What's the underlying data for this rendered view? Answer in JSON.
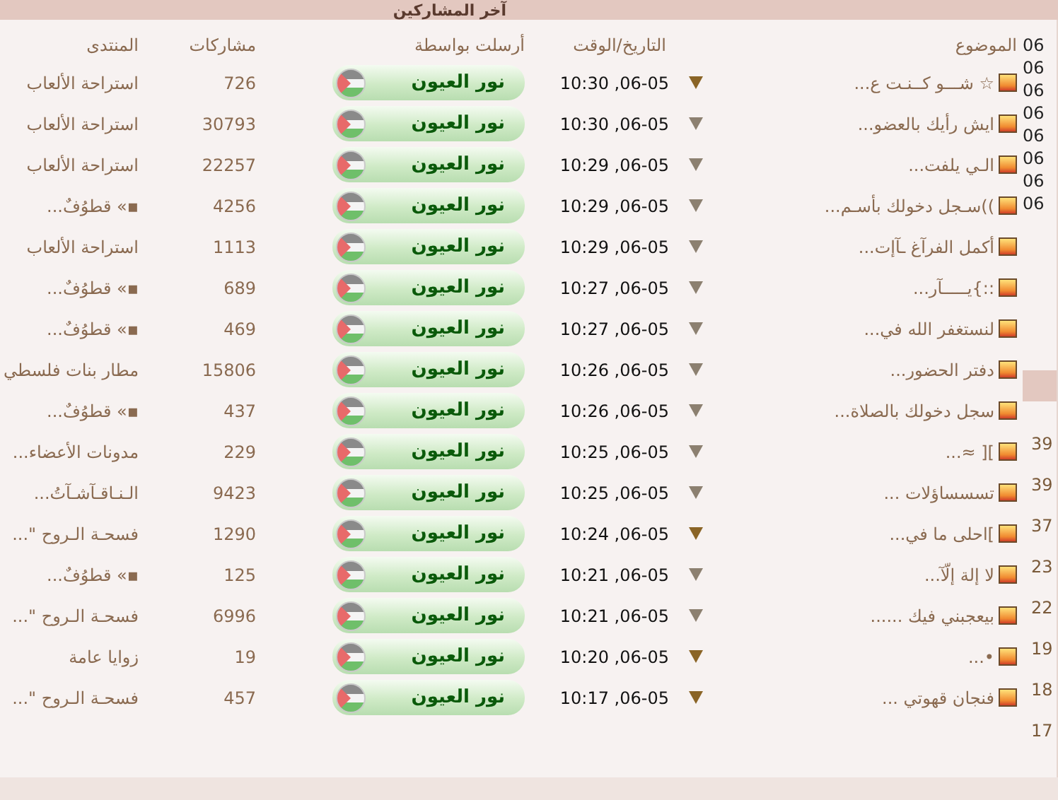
{
  "header": {
    "title": "آخر المشاركين"
  },
  "table": {
    "columns": [
      "الموضوع",
      "التاريخ/الوقت",
      "أرسلت بواسطة",
      "مشاركات",
      "المنتدى"
    ],
    "rows": [
      {
        "topic": "☆ شـــو كــنـت ع...",
        "date": "06-05, 10:30",
        "new": true,
        "sender": "نور العيون",
        "posts": "726",
        "forum": "استراحة الألعاب"
      },
      {
        "topic": "ايش رأيك بالعضو...",
        "date": "06-05, 10:30",
        "new": false,
        "sender": "نور العيون",
        "posts": "30793",
        "forum": "استراحة الألعاب"
      },
      {
        "topic": "الـي يلفت...",
        "date": "06-05, 10:29",
        "new": false,
        "sender": "نور العيون",
        "posts": "22257",
        "forum": "استراحة الألعاب"
      },
      {
        "topic": "))سـجل دخولك بأسـم...",
        "date": "06-05, 10:29",
        "new": false,
        "sender": "نور العيون",
        "posts": "4256",
        "forum": "▪» قطوُفٌ..."
      },
      {
        "topic": "أكمل الفرآغ ـآإت...",
        "date": "06-05, 10:29",
        "new": false,
        "sender": "نور العيون",
        "posts": "1113",
        "forum": "استراحة الألعاب"
      },
      {
        "topic": "::}يـــــآر...",
        "date": "06-05, 10:27",
        "new": false,
        "sender": "نور العيون",
        "posts": "689",
        "forum": "▪» قطوُفٌ..."
      },
      {
        "topic": "لنستغفر الله في...",
        "date": "06-05, 10:27",
        "new": false,
        "sender": "نور العيون",
        "posts": "469",
        "forum": "▪» قطوُفٌ..."
      },
      {
        "topic": "دفتر الحضور...",
        "date": "06-05, 10:26",
        "new": false,
        "sender": "نور العيون",
        "posts": "15806",
        "forum": "مطار بنات فلسطي"
      },
      {
        "topic": "سجل دخولك بالصلاة...",
        "date": "06-05, 10:26",
        "new": false,
        "sender": "نور العيون",
        "posts": "437",
        "forum": "▪» قطوُفٌ..."
      },
      {
        "topic": "][ ≈...",
        "date": "06-05, 10:25",
        "new": false,
        "sender": "نور العيون",
        "posts": "229",
        "forum": "مدونات الأعضاء..."
      },
      {
        "topic": "تسسساؤلات ...",
        "date": "06-05, 10:25",
        "new": false,
        "sender": "نور العيون",
        "posts": "9423",
        "forum": "الـنـاقـآشـآتُ..."
      },
      {
        "topic": "]احلى ما في...",
        "date": "06-05, 10:24",
        "new": true,
        "sender": "نور العيون",
        "posts": "1290",
        "forum": "فسحـة الـروح \"..."
      },
      {
        "topic": "لا إلة إلّآ...",
        "date": "06-05, 10:21",
        "new": false,
        "sender": "نور العيون",
        "posts": "125",
        "forum": "▪» قطوُفٌ..."
      },
      {
        "topic": "بيعجبني فيك ......",
        "date": "06-05, 10:21",
        "new": false,
        "sender": "نور العيون",
        "posts": "6996",
        "forum": "فسحـة الـروح \"..."
      },
      {
        "topic": "•...",
        "date": "06-05, 10:20",
        "new": true,
        "sender": "نور العيون",
        "posts": "19",
        "forum": "زوايا عامة"
      },
      {
        "topic": "فنجان قهوتي ...",
        "date": "06-05, 10:17",
        "new": true,
        "sender": "نور العيون",
        "posts": "457",
        "forum": "فسحـة الـروح \"..."
      }
    ]
  },
  "side_column": {
    "top_items": [
      "06",
      "06",
      "06",
      "06",
      "06",
      "06",
      "06",
      "06"
    ],
    "bottom_items": [
      "39",
      "39",
      "37",
      "23",
      "22",
      "19",
      "18",
      "17"
    ]
  }
}
